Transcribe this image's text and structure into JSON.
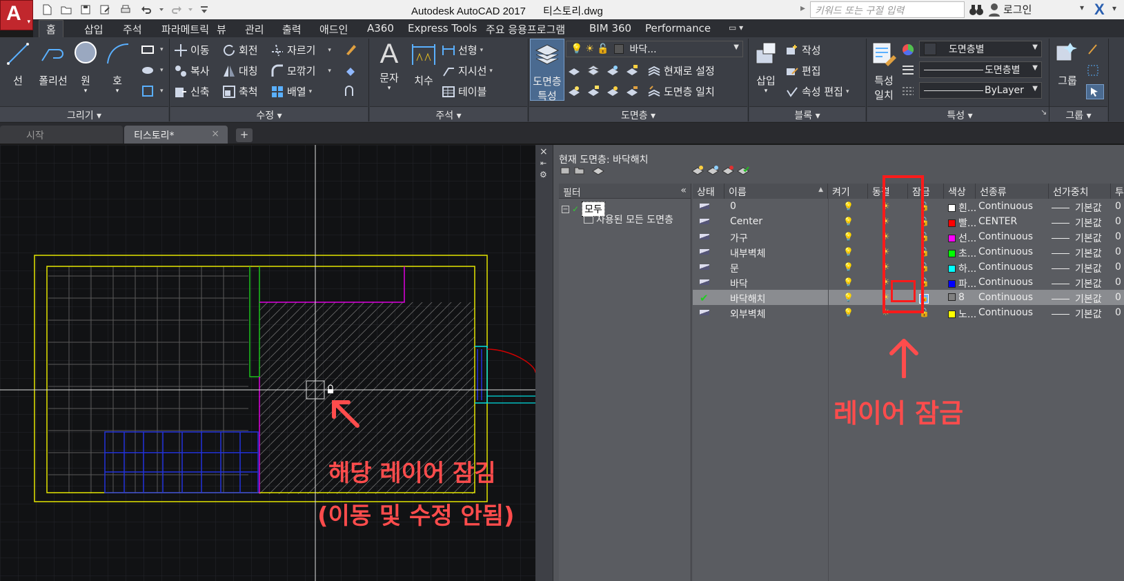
{
  "titlebar": {
    "logo_letter": "A",
    "title": "Autodesk AutoCAD 2017      티스토리.dwg",
    "search_placeholder": "키워드 또는 구절 입력",
    "login": "로그인"
  },
  "ribbon_tabs": [
    "홈",
    "삽입",
    "주석",
    "파라메트릭",
    "뷰",
    "관리",
    "출력",
    "애드인",
    "A360",
    "Express Tools",
    "주요 응용프로그램",
    "BIM 360",
    "Performance"
  ],
  "draw_panel": {
    "title": "그리기",
    "line": "선",
    "polyline": "폴리선",
    "circle": "원",
    "arc": "호"
  },
  "modify_panel": {
    "title": "수정",
    "move": "이동",
    "rotate": "회전",
    "trim": "자르기",
    "copy": "복사",
    "mirror": "대칭",
    "fillet": "모깎기",
    "stretch": "신축",
    "scale": "축척",
    "array": "배열"
  },
  "annotation_panel": {
    "title": "주석",
    "text": "문자",
    "dimension": "치수",
    "linear": "선형",
    "leader": "지시선",
    "table": "테이블"
  },
  "layers_panel": {
    "title": "도면층",
    "properties_line1": "도면층",
    "properties_line2": "특성",
    "layer_dropdown": "바닥...",
    "make_current": "현재로 설정",
    "match_layer": "도면층 일치"
  },
  "block_panel": {
    "title": "블록",
    "insert": "삽입",
    "create": "작성",
    "edit": "편집",
    "attr_edit": "속성 편집"
  },
  "properties_panel": {
    "title": "특성",
    "match_line1": "특성",
    "match_line2": "일치",
    "color": "도면층별",
    "linetype": "도면층별",
    "lineweight": "ByLayer"
  },
  "groups_panel": {
    "title": "그룹",
    "group": "그룹"
  },
  "doc_tabs": {
    "start": "시작",
    "current": "티스토리*"
  },
  "layer_manager": {
    "current_layer": "현재 도면층: 바닥해치",
    "filter_header": "필터",
    "filter_all": "모두",
    "filter_used": "사용된 모든 도면층",
    "columns": [
      "상태",
      "이름",
      "켜기",
      "동결",
      "잠금",
      "색상",
      "선종류",
      "선가중치",
      "투명도"
    ],
    "layers": [
      {
        "name": "0",
        "color_name": "흰...",
        "color": "#ffffff",
        "linetype": "Continuous",
        "lineweight": "기본값",
        "transparency": "0",
        "locked": false,
        "current": false
      },
      {
        "name": "Center",
        "color_name": "빨...",
        "color": "#ff0000",
        "linetype": "CENTER",
        "lineweight": "기본값",
        "transparency": "0",
        "locked": false,
        "current": false
      },
      {
        "name": "가구",
        "color_name": "선...",
        "color": "#ff00ff",
        "linetype": "Continuous",
        "lineweight": "기본값",
        "transparency": "0",
        "locked": false,
        "current": false
      },
      {
        "name": "내부벽체",
        "color_name": "초...",
        "color": "#00ff00",
        "linetype": "Continuous",
        "lineweight": "기본값",
        "transparency": "0",
        "locked": false,
        "current": false
      },
      {
        "name": "문",
        "color_name": "하...",
        "color": "#00ffff",
        "linetype": "Continuous",
        "lineweight": "기본값",
        "transparency": "0",
        "locked": false,
        "current": false
      },
      {
        "name": "바닥",
        "color_name": "파...",
        "color": "#0000ff",
        "linetype": "Continuous",
        "lineweight": "기본값",
        "transparency": "0",
        "locked": false,
        "current": false
      },
      {
        "name": "바닥해치",
        "color_name": "8",
        "color": "#808080",
        "linetype": "Continuous",
        "lineweight": "기본값",
        "transparency": "0",
        "locked": true,
        "current": true
      },
      {
        "name": "외부벽체",
        "color_name": "노...",
        "color": "#ffff00",
        "linetype": "Continuous",
        "lineweight": "기본값",
        "transparency": "0",
        "locked": false,
        "current": false
      }
    ]
  },
  "annotations": {
    "panel_note": "레이어 잠금",
    "canvas_note_line1": "해당 레이어 잠김",
    "canvas_note_line2": "(이동 및 수정 안됨)"
  }
}
